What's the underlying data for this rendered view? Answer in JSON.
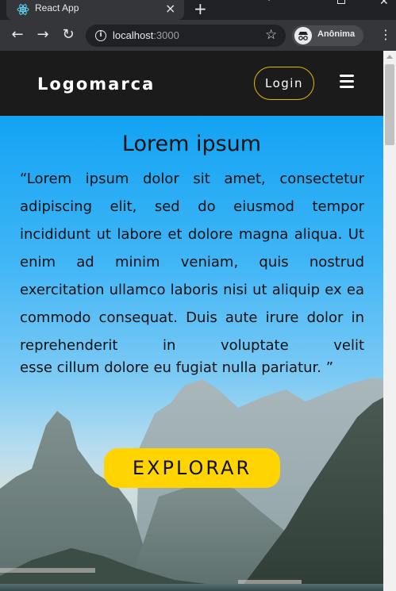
{
  "browser": {
    "tab_title": "React App",
    "tab_close": "×",
    "new_tab": "+",
    "back": "←",
    "forward": "→",
    "reload": "↻",
    "url_host": "localhost",
    "url_port": ":3000",
    "profile_label": "Anônima",
    "bookmark_icon": "star-icon",
    "menu": "⋮"
  },
  "header": {
    "logo": "Logomarca",
    "login_label": "Login",
    "menu_icon": "hamburger-icon",
    "accent": "#e3b800"
  },
  "hero": {
    "title": "Lorem ipsum",
    "quote": "“Lorem ipsum dolor sit amet, consectetur adipiscing elit, sed do eiusmod tempor incididunt ut labore et dolore magna aliqua. Ut enim ad minim veniam, quis nostrud exercitation ullamco laboris nisi ut aliquip ex ea commodo consequat. Duis aute irure dolor in reprehenderit in voluptate velit",
    "quote_end": "esse cillum dolore eu fugiat nulla pariatur. ”",
    "cta_label": "EXPLORAR",
    "cta_color": "#ffd400"
  }
}
